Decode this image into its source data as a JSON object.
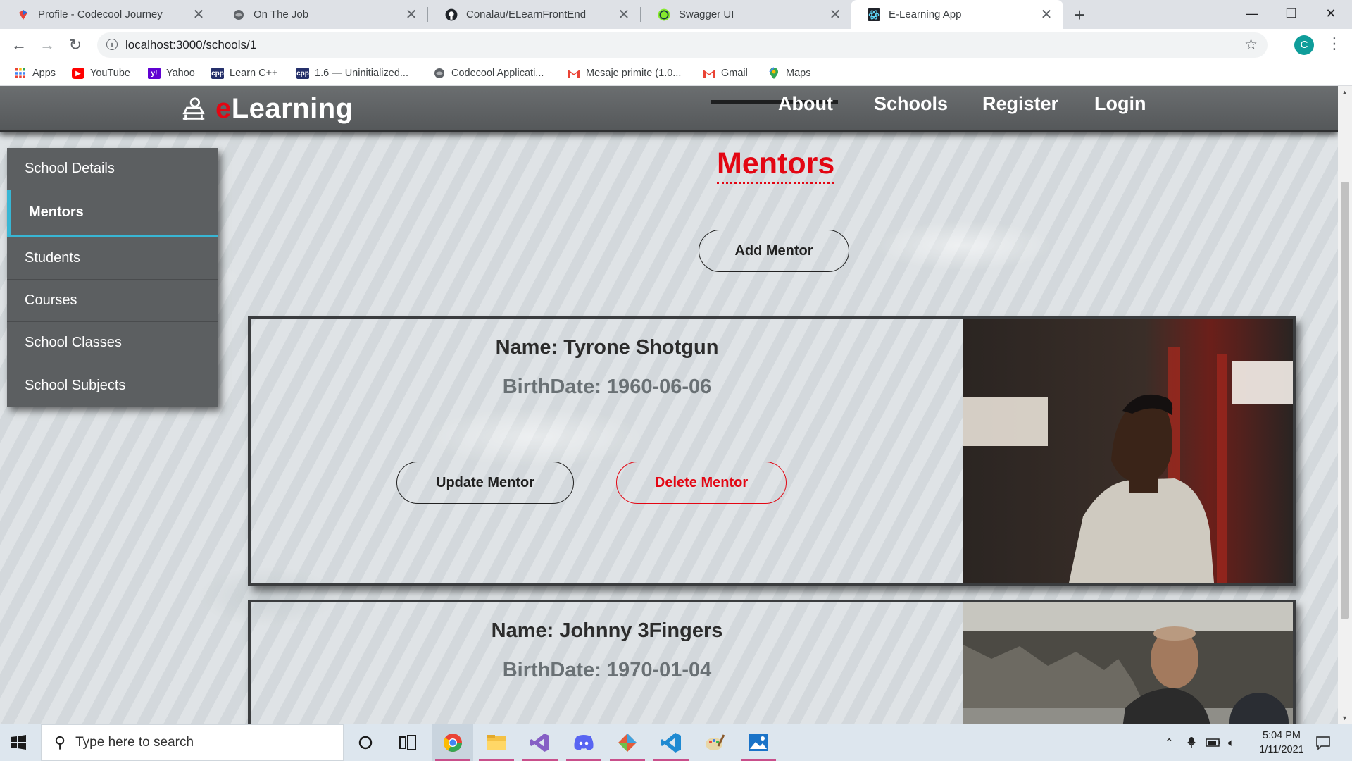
{
  "browser": {
    "tabs": [
      {
        "title": "Profile - Codecool Journey",
        "icon": "codecool-icon",
        "active": false
      },
      {
        "title": "On The Job",
        "icon": "globe-icon",
        "active": false
      },
      {
        "title": "Conalau/ELearnFrontEnd",
        "icon": "github-icon",
        "active": false
      },
      {
        "title": "Swagger UI",
        "icon": "swagger-icon",
        "active": false
      },
      {
        "title": "E-Learning App",
        "icon": "react-icon",
        "active": true
      }
    ],
    "new_tab": "+",
    "url": "localhost:3000/schools/1",
    "profile_initial": "C",
    "bookmarks": [
      {
        "label": "Apps",
        "icon": "apps-grid-icon"
      },
      {
        "label": "YouTube",
        "icon": "youtube-icon"
      },
      {
        "label": "Yahoo",
        "icon": "yahoo-icon"
      },
      {
        "label": "Learn C++",
        "icon": "cpp-icon"
      },
      {
        "label": "1.6 — Uninitialized...",
        "icon": "cpp-icon"
      },
      {
        "label": "Codecool Applicati...",
        "icon": "globe-icon"
      },
      {
        "label": "Mesaje primite (1.0...",
        "icon": "gmail-icon"
      },
      {
        "label": "Gmail",
        "icon": "gmail-icon"
      },
      {
        "label": "Maps",
        "icon": "maps-icon"
      }
    ]
  },
  "site": {
    "brand_e": "e",
    "brand_rest": "Learning",
    "nav": [
      "About",
      "Schools",
      "Register",
      "Login"
    ]
  },
  "sidebar": {
    "items": [
      {
        "label": "School Details",
        "active": false
      },
      {
        "label": "Mentors",
        "active": true
      },
      {
        "label": "Students",
        "active": false
      },
      {
        "label": "Courses",
        "active": false
      },
      {
        "label": "School Classes",
        "active": false
      },
      {
        "label": "School Subjects",
        "active": false
      }
    ]
  },
  "main": {
    "title": "Mentors",
    "add_button": "Add Mentor",
    "mentors": [
      {
        "name": "Name: Tyrone Shotgun",
        "birth": "BirthDate: 1960-06-06",
        "update": "Update Mentor",
        "delete": "Delete Mentor"
      },
      {
        "name": "Name: Johnny 3Fingers",
        "birth": "BirthDate: 1970-01-04"
      }
    ]
  },
  "taskbar": {
    "search_placeholder": "Type here to search",
    "time": "5:04 PM",
    "date": "1/11/2021"
  },
  "colors": {
    "accent_red": "#e30613",
    "sidebar_active": "#38b6d4",
    "navbar": "#5f6264"
  }
}
